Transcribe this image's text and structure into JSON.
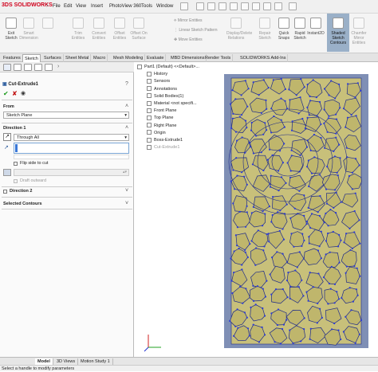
{
  "app": {
    "brand": "SOLIDWORKS",
    "brand_prefix": "3DS"
  },
  "menu": [
    "File",
    "Edit",
    "View",
    "Insert",
    "PhotoView 360",
    "Tools",
    "Window"
  ],
  "ribbon": {
    "buttons": [
      {
        "label": "Exit Sketch",
        "dim": false,
        "active": false
      },
      {
        "label": "Smart Dimension",
        "dim": true,
        "active": false
      },
      {
        "label": "",
        "dim": true,
        "active": false
      },
      {
        "label": "Trim Entities",
        "dim": true,
        "active": false
      },
      {
        "label": "Convert Entities",
        "dim": true,
        "active": false
      },
      {
        "label": "Offset Entities",
        "dim": true,
        "active": false
      },
      {
        "label": "Offset On Surface",
        "dim": true,
        "active": false
      },
      {
        "label": "Display/Delete Relations",
        "dim": true,
        "active": false
      },
      {
        "label": "Repair Sketch",
        "dim": true,
        "active": false
      },
      {
        "label": "Quick Snaps",
        "dim": false,
        "active": false
      },
      {
        "label": "Rapid Sketch",
        "dim": false,
        "active": false
      },
      {
        "label": "Instant2D",
        "dim": false,
        "active": false
      },
      {
        "label": "Shaded Sketch Contours",
        "dim": false,
        "active": true
      },
      {
        "label": "Chamfer Mirror Entities",
        "dim": true,
        "active": false
      }
    ],
    "mirror_row": {
      "mirror": "Mirror Entities",
      "linear": "Linear Sketch Pattern",
      "move": "Move Entities"
    }
  },
  "tabs": [
    "Features",
    "Sketch",
    "Surfaces",
    "Sheet Metal",
    "Macro",
    "Mesh Modeling",
    "Evaluate",
    "MBD Dimensions",
    "Render Tools",
    "SOLIDWORKS Add-Ins"
  ],
  "selected_tab": "Sketch",
  "property_manager": {
    "title": "Cut-Extrude1",
    "from_label": "From",
    "from_value": "Sketch Plane",
    "direction1_label": "Direction 1",
    "end_condition": "Through All",
    "flip_side": "Flip side to cut",
    "draft": "Draft outward",
    "direction2_label": "Direction 2",
    "selected_contours": "Selected Contours"
  },
  "feature_tree": [
    {
      "label": "Part1 (Default) <<Default>...",
      "dim": false,
      "indent": 0
    },
    {
      "label": "History",
      "dim": false,
      "indent": 1
    },
    {
      "label": "Sensors",
      "dim": false,
      "indent": 1
    },
    {
      "label": "Annotations",
      "dim": false,
      "indent": 1
    },
    {
      "label": "Solid Bodies(1)",
      "dim": false,
      "indent": 1
    },
    {
      "label": "Material <not specifi...",
      "dim": false,
      "indent": 1
    },
    {
      "label": "Front Plane",
      "dim": false,
      "indent": 1
    },
    {
      "label": "Top Plane",
      "dim": false,
      "indent": 1
    },
    {
      "label": "Right Plane",
      "dim": false,
      "indent": 1
    },
    {
      "label": "Origin",
      "dim": false,
      "indent": 1
    },
    {
      "label": "Boss-Extrude1",
      "dim": false,
      "indent": 1
    },
    {
      "label": "Cut-Extrude1",
      "dim": true,
      "indent": 1
    }
  ],
  "bottom_tabs": [
    "Model",
    "3D Views",
    "Motion Study 1"
  ],
  "status": "Select a handle to modify parameters",
  "colors": {
    "part_fill": "#c8c07a",
    "part_border": "#6a7aa0",
    "contour": "#1e2a8a",
    "node": "#2a3ad8",
    "active_btn": "#9ab0c8"
  }
}
